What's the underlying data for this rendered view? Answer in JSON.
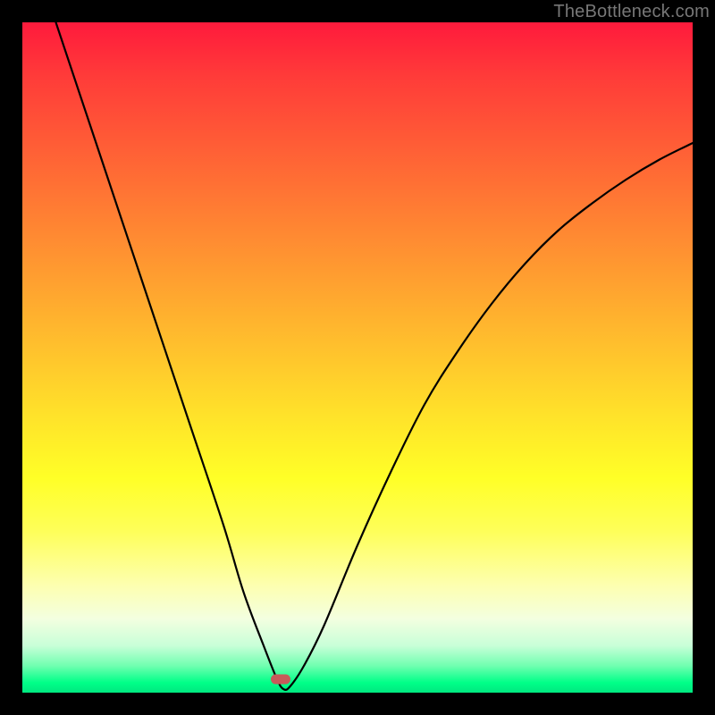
{
  "watermark": "TheBottleneck.com",
  "marker": {
    "x_pct": 38.5,
    "y_pct": 98.0
  },
  "colors": {
    "frame": "#000000",
    "curve": "#000000",
    "marker": "#c75a5a",
    "gradient_top": "#ff1a3c",
    "gradient_bottom": "#00e880"
  },
  "chart_data": {
    "type": "line",
    "title": "",
    "xlabel": "",
    "ylabel": "",
    "xlim": [
      0,
      100
    ],
    "ylim": [
      0,
      100
    ],
    "annotations": [
      "TheBottleneck.com"
    ],
    "series": [
      {
        "name": "bottleneck-curve",
        "x": [
          5,
          10,
          15,
          20,
          25,
          30,
          33,
          36,
          38,
          39,
          40,
          42,
          45,
          50,
          55,
          60,
          65,
          70,
          75,
          80,
          85,
          90,
          95,
          100
        ],
        "y": [
          100,
          85,
          70,
          55,
          40,
          25,
          15,
          7,
          2,
          0.5,
          1,
          4,
          10,
          22,
          33,
          43,
          51,
          58,
          64,
          69,
          73,
          76.5,
          79.5,
          82
        ]
      }
    ],
    "marker_point": {
      "x": 39,
      "y": 0.5
    },
    "background_scale": {
      "type": "vertical-gradient",
      "meaning": "red=high bottleneck, green=low bottleneck",
      "stops": [
        {
          "pct": 0,
          "color": "#ff1a3c"
        },
        {
          "pct": 50,
          "color": "#ffe02a"
        },
        {
          "pct": 100,
          "color": "#00e880"
        }
      ]
    }
  }
}
